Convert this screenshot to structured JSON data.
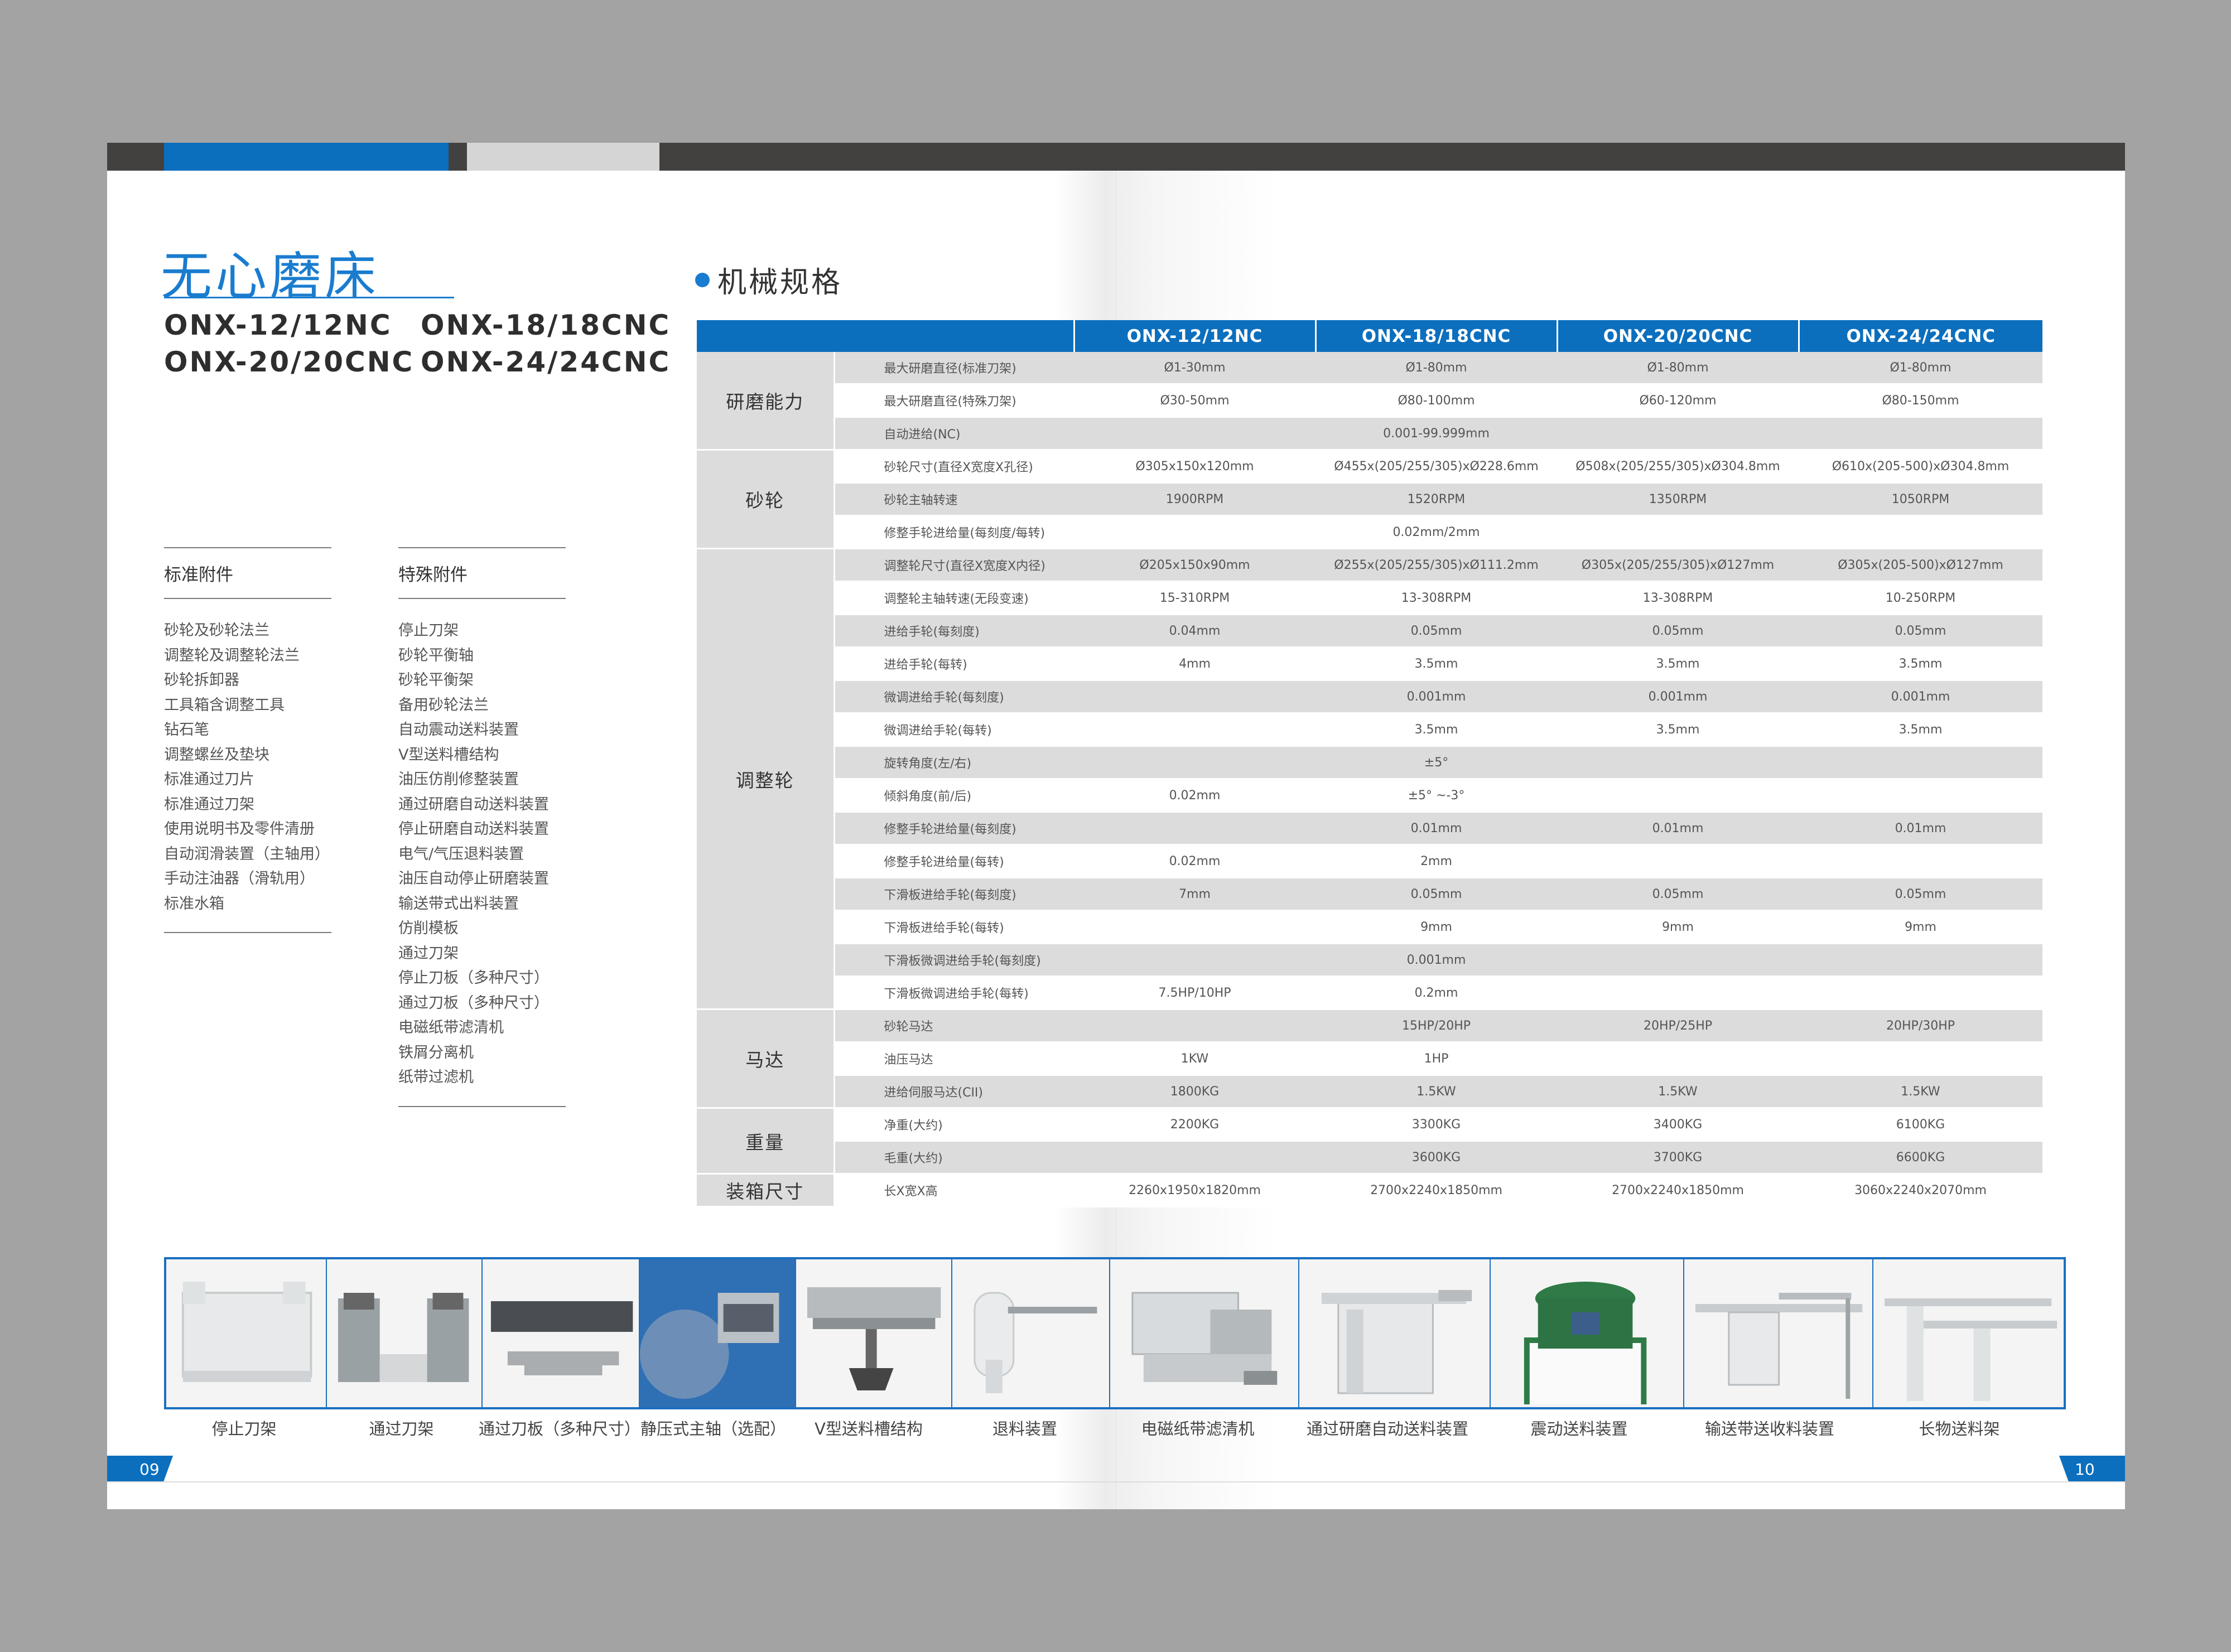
{
  "title": "无心磨床",
  "models": [
    "ONX-12/12NC",
    "ONX-18/18CNC",
    "ONX-20/20CNC",
    "ONX-24/24CNC"
  ],
  "standard_accessories": {
    "heading": "标准附件",
    "items": [
      "砂轮及砂轮法兰",
      "调整轮及调整轮法兰",
      "砂轮拆卸器",
      "工具箱含调整工具",
      "钻石笔",
      "调整螺丝及垫块",
      "标准通过刀片",
      "标准通过刀架",
      "使用说明书及零件清册",
      "自动润滑装置（主轴用）",
      "手动注油器（滑轨用）",
      "标准水箱"
    ]
  },
  "special_accessories": {
    "heading": "特殊附件",
    "items": [
      "停止刀架",
      "砂轮平衡轴",
      "砂轮平衡架",
      "备用砂轮法兰",
      "自动震动送料装置",
      "V型送料槽结构",
      "油压仿削修整装置",
      "通过研磨自动送料装置",
      "停止研磨自动送料装置",
      "电气/气压退料装置",
      "油压自动停止研磨装置",
      "输送带式出料装置",
      "仿削模板",
      "通过刀架",
      "停止刀板（多种尺寸）",
      "通过刀板（多种尺寸）",
      "电磁纸带滤清机",
      "铁屑分离机",
      "纸带过滤机"
    ]
  },
  "spec_section": {
    "heading": "机械规格"
  },
  "spec_table": {
    "columns": [
      "ONX-12/12NC",
      "ONX-18/18CNC",
      "ONX-20/20CNC",
      "ONX-24/24CNC"
    ],
    "groups": [
      {
        "name": "研磨能力",
        "rows": [
          {
            "item": "最大研磨直径(标准刀架)",
            "values": [
              "Ø1-30mm",
              "Ø1-80mm",
              "Ø1-80mm",
              "Ø1-80mm"
            ]
          },
          {
            "item": "最大研磨直径(特殊刀架)",
            "values": [
              "Ø30-50mm",
              "Ø80-100mm",
              "Ø60-120mm",
              "Ø80-150mm"
            ]
          },
          {
            "item": "自动进给(NC)",
            "values": [
              "",
              "0.001-99.999mm",
              "",
              ""
            ]
          }
        ]
      },
      {
        "name": "砂轮",
        "rows": [
          {
            "item": "砂轮尺寸(直径X宽度X孔径)",
            "values": [
              "Ø305x150x120mm",
              "Ø455x(205/255/305)xØ228.6mm",
              "Ø508x(205/255/305)xØ304.8mm",
              "Ø610x(205-500)xØ304.8mm"
            ]
          },
          {
            "item": "砂轮主轴转速",
            "values": [
              "1900RPM",
              "1520RPM",
              "1350RPM",
              "1050RPM"
            ]
          },
          {
            "item": "修整手轮进给量(每刻度/每转)",
            "values": [
              "",
              "0.02mm/2mm",
              "",
              ""
            ]
          }
        ]
      },
      {
        "name": "调整轮",
        "rows": [
          {
            "item": "调整轮尺寸(直径X宽度X内径)",
            "values": [
              "Ø205x150x90mm",
              "Ø255x(205/255/305)xØ111.2mm",
              "Ø305x(205/255/305)xØ127mm",
              "Ø305x(205-500)xØ127mm"
            ]
          },
          {
            "item": "调整轮主轴转速(无段变速)",
            "values": [
              "15-310RPM",
              "13-308RPM",
              "13-308RPM",
              "10-250RPM"
            ]
          },
          {
            "item": "进给手轮(每刻度)",
            "values": [
              "0.04mm",
              "0.05mm",
              "0.05mm",
              "0.05mm"
            ]
          },
          {
            "item": "进给手轮(每转)",
            "values": [
              "4mm",
              "3.5mm",
              "3.5mm",
              "3.5mm"
            ]
          },
          {
            "item": "微调进给手轮(每刻度)",
            "values": [
              "",
              "0.001mm",
              "0.001mm",
              "0.001mm"
            ]
          },
          {
            "item": "微调进给手轮(每转)",
            "values": [
              "",
              "3.5mm",
              "3.5mm",
              "3.5mm"
            ]
          },
          {
            "item": "旋转角度(左/右)",
            "values": [
              "",
              "±5°",
              "",
              ""
            ]
          },
          {
            "item": "倾斜角度(前/后)",
            "values": [
              "0.02mm",
              "±5° ~-3°",
              "",
              ""
            ]
          },
          {
            "item": "修整手轮进给量(每刻度)",
            "values": [
              "",
              "0.01mm",
              "0.01mm",
              "0.01mm"
            ]
          },
          {
            "item": "修整手轮进给量(每转)",
            "values": [
              "0.02mm",
              "2mm",
              "",
              ""
            ]
          },
          {
            "item": "下滑板进给手轮(每刻度)",
            "values": [
              "7mm",
              "0.05mm",
              "0.05mm",
              "0.05mm"
            ]
          },
          {
            "item": "下滑板进给手轮(每转)",
            "values": [
              "",
              "9mm",
              "9mm",
              "9mm"
            ]
          },
          {
            "item": "下滑板微调进给手轮(每刻度)",
            "values": [
              "",
              "0.001mm",
              "",
              ""
            ]
          },
          {
            "item": "下滑板微调进给手轮(每转)",
            "values": [
              "7.5HP/10HP",
              "0.2mm",
              "",
              ""
            ]
          }
        ]
      },
      {
        "name": "马达",
        "rows": [
          {
            "item": "砂轮马达",
            "values": [
              "",
              "15HP/20HP",
              "20HP/25HP",
              "20HP/30HP"
            ]
          },
          {
            "item": "油压马达",
            "values": [
              "1KW",
              "1HP",
              "",
              ""
            ]
          },
          {
            "item": "进给伺服马达(CII)",
            "values": [
              "1800KG",
              "1.5KW",
              "1.5KW",
              "1.5KW"
            ]
          }
        ]
      },
      {
        "name": "重量",
        "rows": [
          {
            "item": "净重(大约)",
            "values": [
              "2200KG",
              "3300KG",
              "3400KG",
              "6100KG"
            ]
          },
          {
            "item": "毛重(大约)",
            "values": [
              "",
              "3600KG",
              "3700KG",
              "6600KG"
            ]
          }
        ]
      },
      {
        "name": "装箱尺寸",
        "rows": [
          {
            "item": "长X宽X高",
            "values": [
              "2260x1950x1820mm",
              "2700x2240x1850mm",
              "2700x2240x1850mm",
              "3060x2240x2070mm"
            ]
          }
        ]
      }
    ]
  },
  "products": [
    {
      "caption": "停止刀架",
      "icon": "stop-blade-holder-photo"
    },
    {
      "caption": "通过刀架",
      "icon": "through-blade-holder-photo"
    },
    {
      "caption": "通过刀板（多种尺寸）",
      "icon": "through-blade-plate-photo"
    },
    {
      "caption": "静压式主轴（选配）",
      "icon": "hydrostatic-spindle-photo"
    },
    {
      "caption": "V型送料槽结构",
      "icon": "v-feed-trough-photo"
    },
    {
      "caption": "退料装置",
      "icon": "unloading-device-photo"
    },
    {
      "caption": "电磁纸带滤清机",
      "icon": "magnetic-paper-filter-photo"
    },
    {
      "caption": "通过研磨自动送料装置",
      "icon": "through-grinding-feeder-photo"
    },
    {
      "caption": "震动送料装置",
      "icon": "vibratory-feeder-photo"
    },
    {
      "caption": "输送带送收料装置",
      "icon": "conveyor-loader-photo"
    },
    {
      "caption": "长物送料架",
      "icon": "long-bar-feed-rack-photo"
    }
  ],
  "page_numbers": {
    "left": "09",
    "right": "10"
  },
  "colors": {
    "accent": "#0b6fbe",
    "title": "#1a7ccf",
    "header_bar": "#434040",
    "row_grey": "#dcdcdc",
    "background": "#a3a3a3"
  }
}
